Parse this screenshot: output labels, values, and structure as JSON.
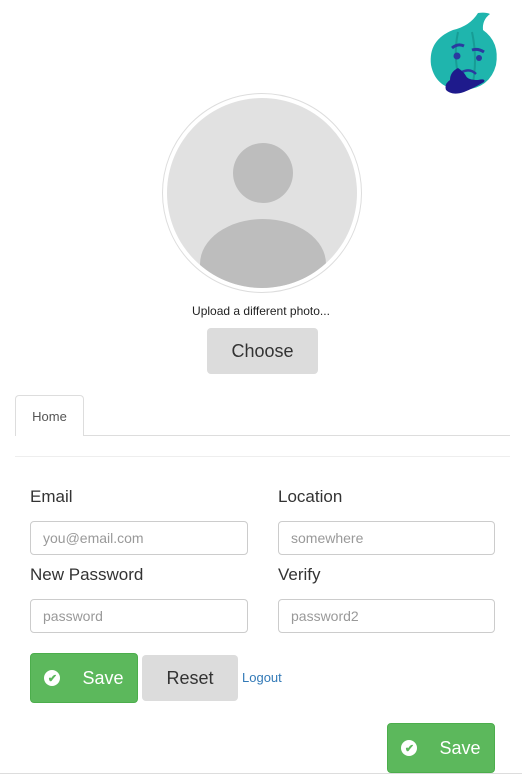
{
  "logo": {
    "name": "thinking-onion-logo",
    "colors": {
      "onion": "#1fb5ad",
      "hand": "#1e1a8c"
    }
  },
  "profile": {
    "upload_text": "Upload a different photo...",
    "choose_label": "Choose"
  },
  "tabs": [
    {
      "label": "Home",
      "active": true
    }
  ],
  "form": {
    "email": {
      "label": "Email",
      "placeholder": "you@email.com",
      "value": ""
    },
    "location": {
      "label": "Location",
      "placeholder": "somewhere",
      "value": ""
    },
    "password": {
      "label": "New Password",
      "placeholder": "password",
      "value": ""
    },
    "verify": {
      "label": "Verify",
      "placeholder": "password2",
      "value": ""
    }
  },
  "actions": {
    "save_label": "Save",
    "reset_label": "Reset",
    "logout_label": "Logout",
    "save2_label": "Save"
  },
  "colors": {
    "success": "#5cb85c",
    "link": "#337ab7"
  }
}
